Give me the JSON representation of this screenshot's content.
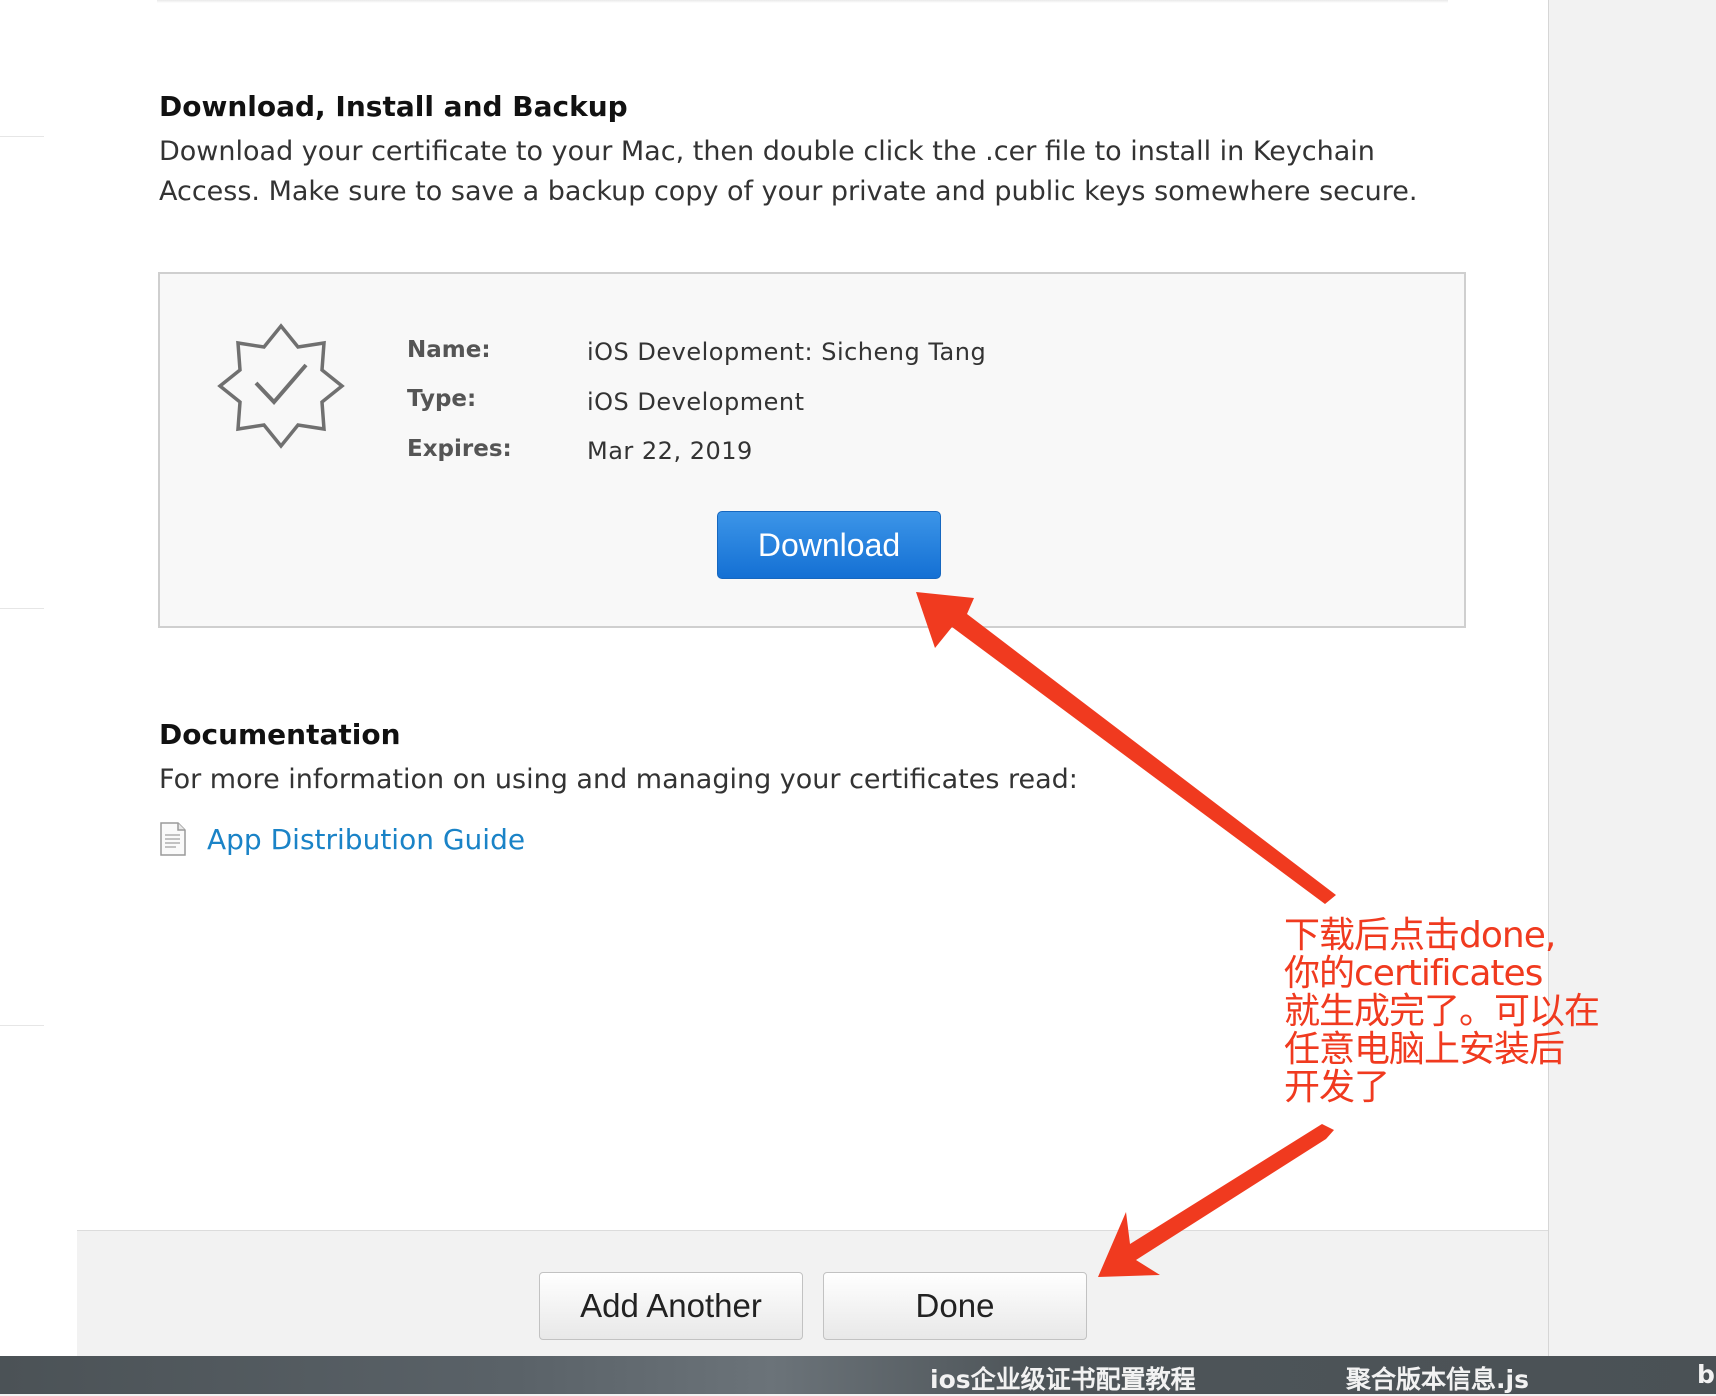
{
  "section_download": {
    "title": "Download, Install and Backup",
    "line1": "Download your certificate to your Mac, then double click the .cer file to install in Keychain",
    "line2": "Access. Make sure to save a backup copy of your private and public keys somewhere secure."
  },
  "certificate": {
    "name_label": "Name:",
    "name_value": "iOS Development: Sicheng Tang",
    "type_label": "Type:",
    "type_value": "iOS Development",
    "expires_label": "Expires:",
    "expires_value": "Mar 22, 2019",
    "download_label": "Download",
    "icon": "certificate-seal-icon"
  },
  "section_docs": {
    "title": "Documentation",
    "text": "For more information on using and managing your certificates read:",
    "link_label": "App Distribution Guide",
    "link_icon": "document-icon"
  },
  "footer": {
    "add_another_label": "Add Another",
    "done_label": "Done"
  },
  "annotation": {
    "lines": [
      "下载后点击done,",
      "你的certificates",
      "就生成完了。可以在",
      "任意电脑上安装后",
      "开发了"
    ],
    "color": "#f03a1f"
  },
  "taskbar": {
    "items": [
      "ios企业级证书配置教程",
      "聚合版本信息.js",
      "b"
    ]
  },
  "colors": {
    "primary_button": "#1a78d8",
    "link": "#1a83c7"
  }
}
